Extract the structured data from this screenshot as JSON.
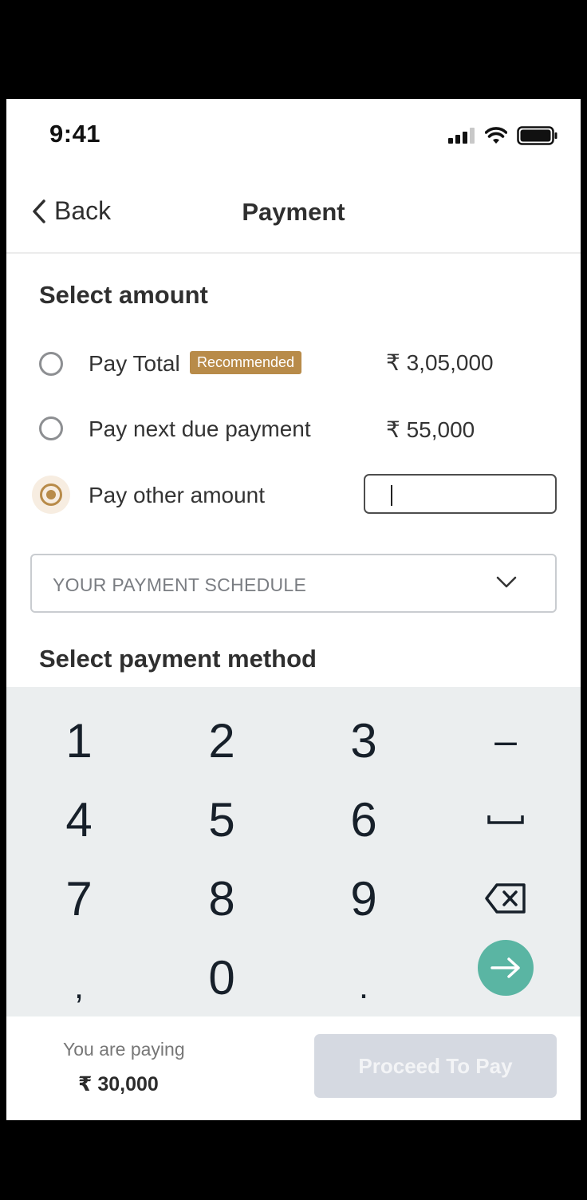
{
  "status_bar": {
    "time": "9:41",
    "icons": [
      "cellular-signal-icon",
      "wifi-icon",
      "battery-icon"
    ]
  },
  "nav": {
    "back_label": "Back",
    "title": "Payment"
  },
  "select_amount": {
    "title": "Select amount",
    "options": [
      {
        "label": "Pay Total",
        "badge": "Recommended",
        "amount": "₹ 3,05,000",
        "selected": false
      },
      {
        "label": "Pay next due payment",
        "amount": "₹ 55,000",
        "selected": false
      },
      {
        "label": "Pay other amount",
        "input_value": "",
        "selected": true
      }
    ]
  },
  "schedule_dropdown": {
    "label": "YOUR PAYMENT SCHEDULE",
    "icon": "chevron-down-icon"
  },
  "payment_method": {
    "title": "Select payment method"
  },
  "keypad": {
    "rows": [
      [
        "1",
        "2",
        "3",
        "–"
      ],
      [
        "4",
        "5",
        "6",
        "space-key-icon"
      ],
      [
        "7",
        "8",
        "9",
        "backspace-icon"
      ],
      [
        ",",
        "0",
        ".",
        "arrow-right-icon"
      ]
    ]
  },
  "footer": {
    "paying_label": "You are paying",
    "paying_amount": "₹ 30,000",
    "proceed_label": "Proceed To Pay"
  },
  "colors": {
    "accent": "#b88b49",
    "go_button": "#5ab5a3",
    "keypad_bg": "#ebeeef",
    "disabled_button": "#d5d9e1"
  }
}
